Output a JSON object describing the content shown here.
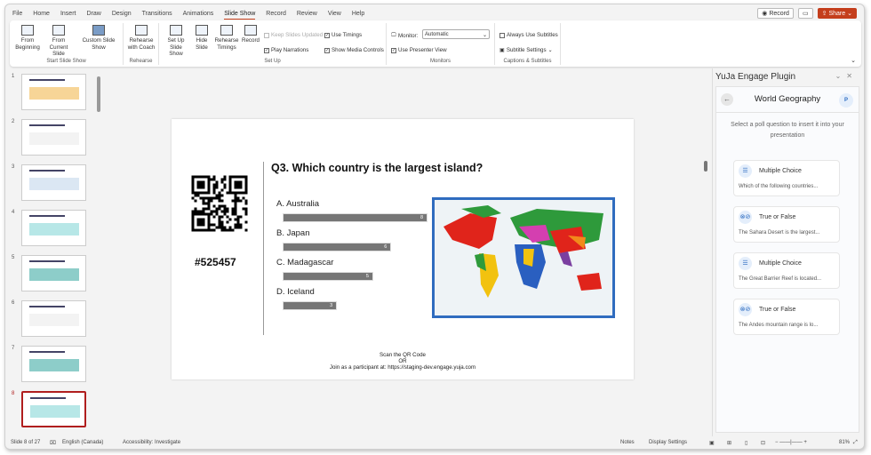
{
  "ribbon_tabs": [
    "File",
    "Home",
    "Insert",
    "Draw",
    "Design",
    "Transitions",
    "Animations",
    "Slide Show",
    "Record",
    "Review",
    "View",
    "Help"
  ],
  "active_tab": "Slide Show",
  "top_buttons": {
    "record": "Record",
    "share": "Share"
  },
  "groups": {
    "start": "Start Slide Show",
    "rehearse": "Rehearse",
    "setup": "Set Up",
    "monitors": "Monitors",
    "captions": "Captions & Subtitles"
  },
  "buttons": {
    "from_beginning": "From Beginning",
    "from_current": "From Current Slide",
    "custom": "Custom Slide Show",
    "coach": "Rehearse with Coach",
    "setup_show": "Set Up Slide Show",
    "hide": "Hide Slide",
    "timings": "Rehearse Timings",
    "record": "Record"
  },
  "checks": {
    "keep_updated": "Keep Slides Updated",
    "play_narrations": "Play Narrations",
    "use_timings": "Use Timings",
    "media_controls": "Show Media Controls",
    "monitor_label": "Monitor:",
    "monitor_value": "Automatic",
    "presenter_view": "Use Presenter View",
    "always_subtitles": "Always Use Subtitles",
    "subtitle_settings": "Subtitle Settings"
  },
  "thumbnails": [
    "1",
    "2",
    "3",
    "4",
    "5",
    "6",
    "7",
    "8",
    "9"
  ],
  "selected_slide": 8,
  "slide": {
    "question": "Q3. Which country is the largest island?",
    "code": "#525457",
    "options": [
      {
        "label": "A. Australia",
        "votes": 8
      },
      {
        "label": "B. Japan",
        "votes": 6
      },
      {
        "label": "C. Madagascar",
        "votes": 5
      },
      {
        "label": "D. Iceland",
        "votes": 3
      }
    ],
    "footer": [
      "Scan the QR Code",
      "OR",
      "Join as a participant at: https://staging-dev.engage.yuja.com"
    ]
  },
  "pane": {
    "title": "YuJa Engage Plugin",
    "name": "World Geography",
    "avatar": "P",
    "hint": "Select a poll question to insert it into your presentation",
    "cards": [
      {
        "type": "Multiple Choice",
        "text": "Which of the following countries...",
        "icon": "list-icon"
      },
      {
        "type": "True or False",
        "text": "The Sahara Desert is the largest...",
        "icon": "true-false-icon"
      },
      {
        "type": "Multiple Choice",
        "text": "The Great Barrier Reef is located...",
        "icon": "list-icon"
      },
      {
        "type": "True or False",
        "text": "The Andes mountain range is lo...",
        "icon": "true-false-icon"
      }
    ]
  },
  "status": {
    "slide": "Slide 8 of 27",
    "lang": "English (Canada)",
    "access": "Accessibility: Investigate",
    "notes": "Notes",
    "display": "Display Settings",
    "zoom": "81%"
  },
  "colors": {
    "accent": "#c43e1c",
    "map_border": "#2f6cbf",
    "bar": "#767676"
  }
}
